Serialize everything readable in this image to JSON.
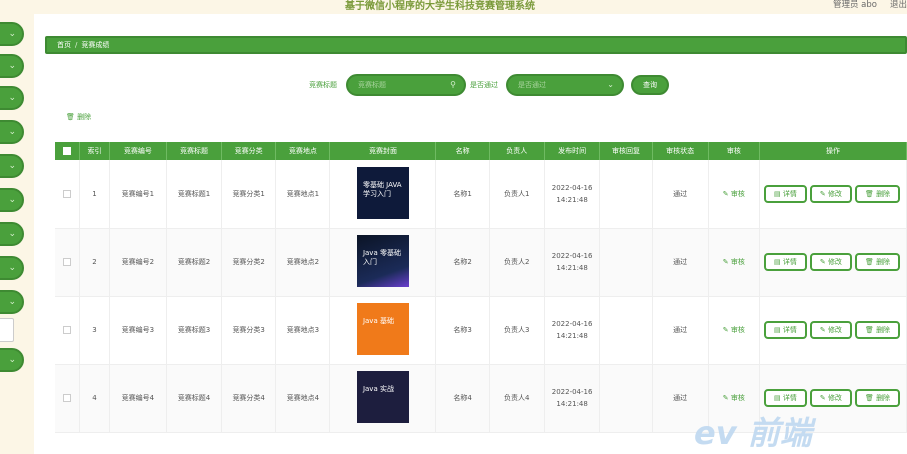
{
  "header": {
    "title": "基于微信小程序的大学生科技竞赛管理系统",
    "user": "管理员 abo",
    "logout": "退出"
  },
  "breadcrumb": {
    "home": "首页",
    "current": "竞赛成绩"
  },
  "search": {
    "label1": "竞赛标题",
    "placeholder1": "竞赛标题",
    "label2": "是否通过",
    "placeholder2": "是否通过",
    "query_button": "查询"
  },
  "delete_link": "删除",
  "table": {
    "headers": [
      "",
      "索引",
      "竞赛编号",
      "竞赛标题",
      "竞赛分类",
      "竞赛地点",
      "竞赛封面",
      "名称",
      "负责人",
      "发布时间",
      "审核回复",
      "审核状态",
      "审核",
      "操作"
    ],
    "rows": [
      {
        "index": "1",
        "code": "竞赛编号1",
        "title": "竞赛标题1",
        "category": "竞赛分类1",
        "place": "竞赛地点1",
        "cover_text": "零基础 JAVA 学习入门",
        "name": "名称1",
        "leader": "负责人1",
        "date": "2022-04-16",
        "time": "14:21:48",
        "reply": "",
        "status": "通过",
        "audit": "审核"
      },
      {
        "index": "2",
        "code": "竞赛编号2",
        "title": "竞赛标题2",
        "category": "竞赛分类2",
        "place": "竞赛地点2",
        "cover_text": "Java 零基础入门",
        "name": "名称2",
        "leader": "负责人2",
        "date": "2022-04-16",
        "time": "14:21:48",
        "reply": "",
        "status": "通过",
        "audit": "审核"
      },
      {
        "index": "3",
        "code": "竞赛编号3",
        "title": "竞赛标题3",
        "category": "竞赛分类3",
        "place": "竞赛地点3",
        "cover_text": "Java 基础",
        "name": "名称3",
        "leader": "负责人3",
        "date": "2022-04-16",
        "time": "14:21:48",
        "reply": "",
        "status": "通过",
        "audit": "审核"
      },
      {
        "index": "4",
        "code": "竞赛编号4",
        "title": "竞赛标题4",
        "category": "竞赛分类4",
        "place": "竞赛地点4",
        "cover_text": "Java 实战",
        "name": "名称4",
        "leader": "负责人4",
        "date": "2022-04-16",
        "time": "14:21:48",
        "reply": "",
        "status": "通过",
        "audit": "审核"
      }
    ]
  },
  "actions": {
    "detail": "详情",
    "edit": "修改",
    "delete": "删除"
  },
  "watermark": "ev 前端",
  "colors": {
    "primary": "#4aa03c",
    "sidebar_bg": "#fcf6e6"
  }
}
